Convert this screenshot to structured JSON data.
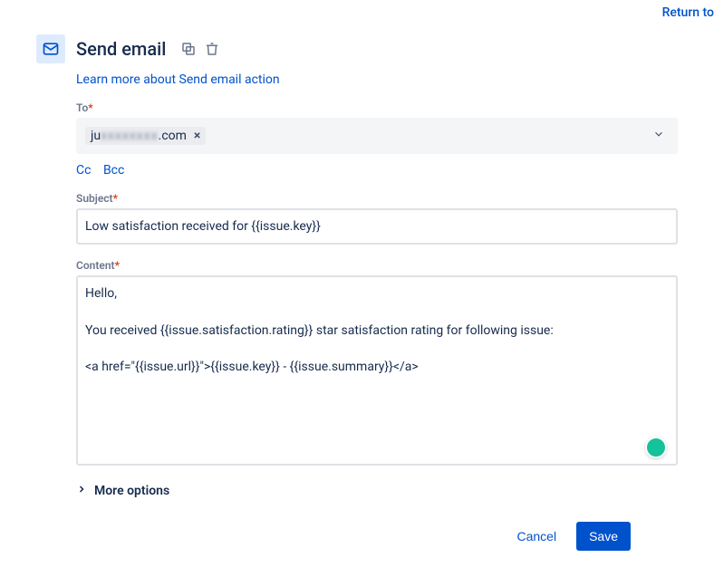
{
  "top": {
    "return_label": "Return to"
  },
  "header": {
    "title": "Send email"
  },
  "learn_link": "Learn more about Send email action",
  "labels": {
    "to": "To",
    "subject": "Subject",
    "content": "Content"
  },
  "to": {
    "chip_prefix": "ju",
    "chip_blur": "xxxxxxxx",
    "chip_suffix": ".com"
  },
  "cc": {
    "cc": "Cc",
    "bcc": "Bcc"
  },
  "subject": {
    "value": "Low satisfaction received for {{issue.key}}"
  },
  "content": {
    "value": "Hello,\n\nYou received {{issue.satisfaction.rating}} star satisfaction rating for following issue:\n\n<a href=\"{{issue.url}}\">{{issue.key}} - {{issue.summary}}</a>"
  },
  "more_options": "More options",
  "footer": {
    "cancel": "Cancel",
    "save": "Save"
  }
}
